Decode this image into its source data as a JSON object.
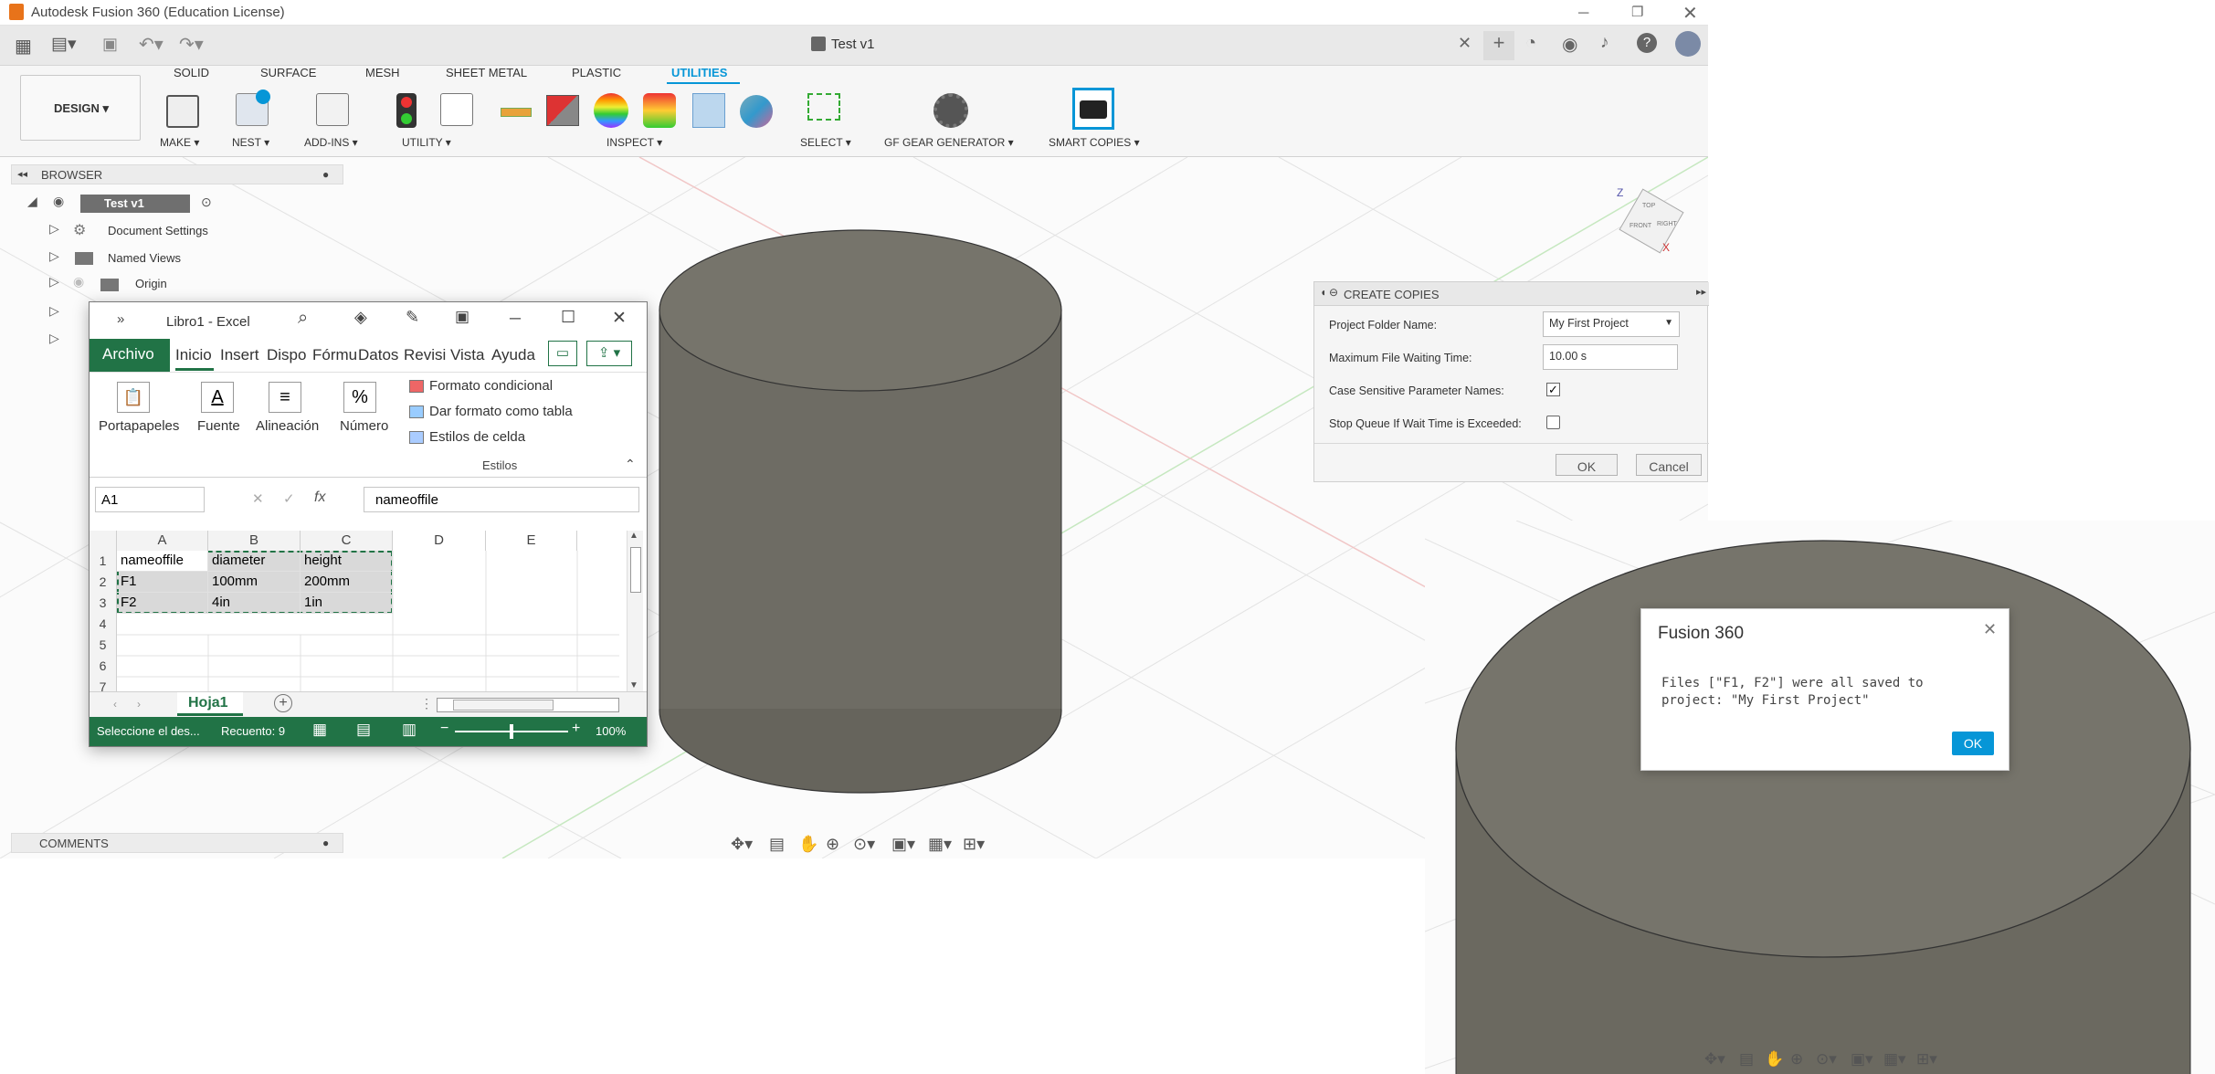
{
  "fusion": {
    "window_title": "Autodesk Fusion 360 (Education License)",
    "doc_title": "Test v1",
    "ribbon": {
      "workspace": "DESIGN ▾",
      "tabs": [
        "SOLID",
        "SURFACE",
        "MESH",
        "SHEET METAL",
        "PLASTIC",
        "UTILITIES"
      ],
      "groups": [
        "MAKE ▾",
        "NEST ▾",
        "ADD-INS ▾",
        "UTILITY ▾",
        "INSPECT ▾",
        "SELECT ▾",
        "GF GEAR GENERATOR ▾",
        "SMART COPIES ▾"
      ]
    },
    "browser": {
      "title": "BROWSER",
      "root": "Test v1",
      "items": [
        "Document Settings",
        "Named Views",
        "Origin"
      ]
    },
    "comments": "COMMENTS",
    "viewcube": {
      "top": "TOP",
      "front": "FRONT",
      "right": "RIGHT",
      "z": "Z",
      "x": "X"
    },
    "create_copies": {
      "title": "CREATE COPIES",
      "project_folder_label": "Project Folder Name:",
      "project_folder_value": "My First Project",
      "wait_time_label": "Maximum File Waiting Time:",
      "wait_time_value": "10.00 s",
      "case_sensitive_label": "Case Sensitive Parameter Names:",
      "case_sensitive_checked": true,
      "stop_queue_label": "Stop Queue If Wait Time is Exceeded:",
      "stop_queue_checked": false,
      "ok": "OK",
      "cancel": "Cancel"
    },
    "message_dialog": {
      "title": "Fusion 360",
      "message": "Files [\"F1, F2\"] were all saved to project: \"My First Project\"",
      "ok": "OK"
    }
  },
  "excel": {
    "title": "Libro1 - Excel",
    "quick": "»",
    "tabs": [
      "Archivo",
      "Inicio",
      "Insert",
      "Dispo",
      "Fórmu",
      "Datos",
      "Revisi",
      "Vista",
      "Ayuda"
    ],
    "groups": {
      "portapapeles": "Portapapeles",
      "fuente": "Fuente",
      "alineacion": "Alineación",
      "numero": "Número",
      "estilos": "Estilos",
      "formato_condicional": "Formato condicional",
      "dar_formato": "Dar formato como tabla",
      "estilos_celda": "Estilos de celda"
    },
    "name_box": "A1",
    "formula": "nameoffile",
    "fx": "fx",
    "columns": [
      "A",
      "B",
      "C",
      "D",
      "E"
    ],
    "rows": [
      {
        "n": "1",
        "a": "nameoffile",
        "b": "diameter",
        "c": "height"
      },
      {
        "n": "2",
        "a": "F1",
        "b": "100mm",
        "c": "200mm"
      },
      {
        "n": "3",
        "a": "F2",
        "b": "4in",
        "c": "1in"
      },
      {
        "n": "4",
        "a": "",
        "b": "",
        "c": ""
      },
      {
        "n": "5",
        "a": "",
        "b": "",
        "c": ""
      },
      {
        "n": "6",
        "a": "",
        "b": "",
        "c": ""
      },
      {
        "n": "7",
        "a": "",
        "b": "",
        "c": ""
      }
    ],
    "sheet": "Hoja1",
    "status": "Seleccione el des...",
    "count": "Recuento: 9",
    "zoom": "100%"
  }
}
